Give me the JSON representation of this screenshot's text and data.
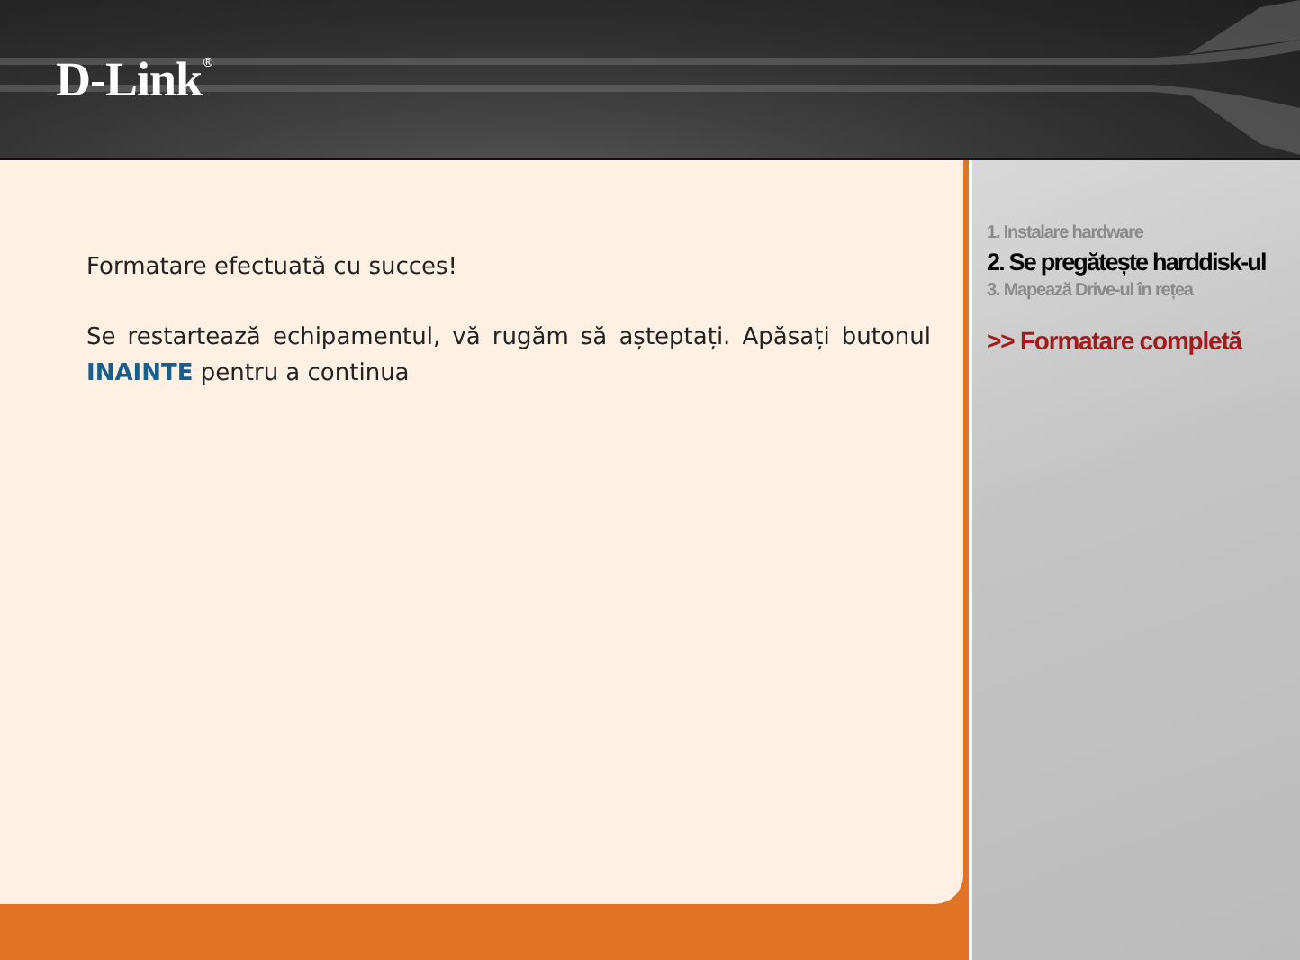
{
  "header": {
    "logo": "D-Link",
    "logo_mark": "®"
  },
  "message": {
    "title": "Formatare efectuată cu succes!",
    "body": " Se restartează echipamentul, vă rugăm să așteptați. Apăsați butonul **INAINTE** pentru a continua"
  },
  "steps": [
    {
      "label": "1. Instalare hardware",
      "kind": "done"
    },
    {
      "label": "2. Se pregătește harddisk-ul",
      "kind": "current"
    },
    {
      "label": "3. Mapează Drive-ul în rețea",
      "kind": "pending"
    },
    {
      "label": ">> Formatare completă",
      "kind": "active"
    }
  ]
}
